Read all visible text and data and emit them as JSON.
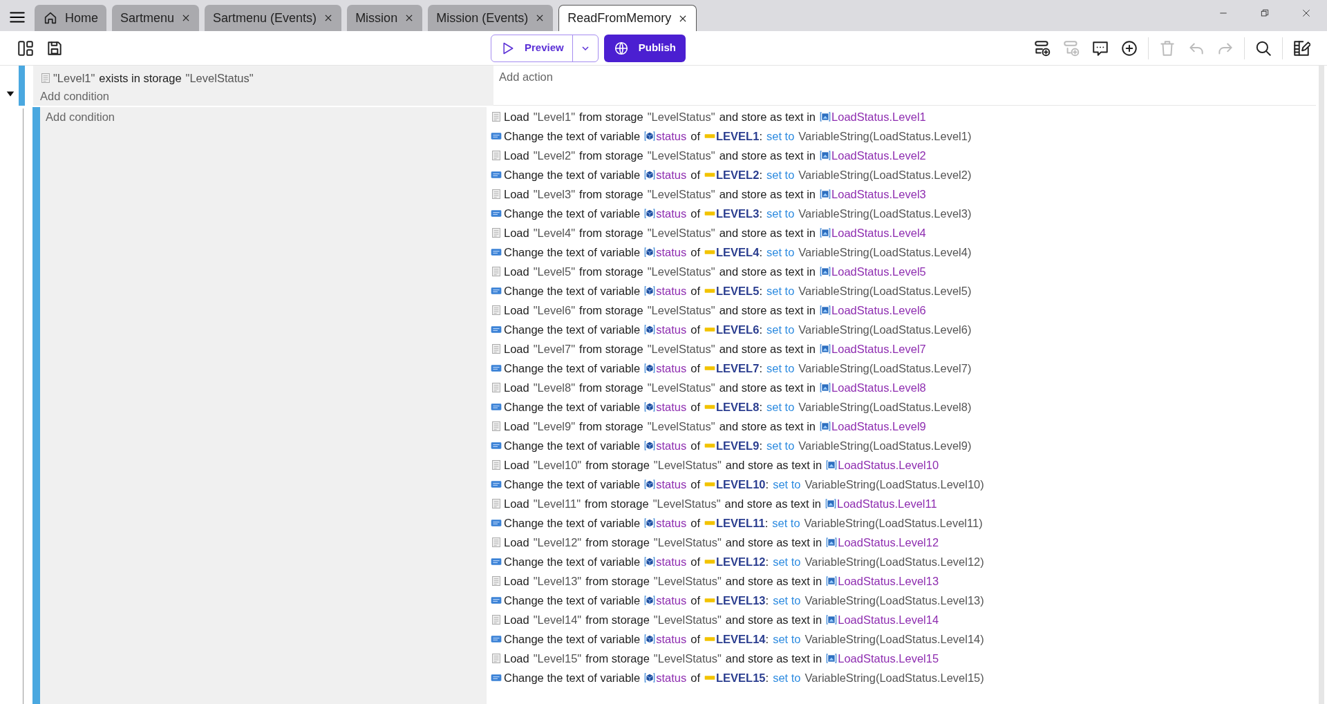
{
  "tabs": [
    {
      "label": "Home",
      "kind": "home",
      "selected": false
    },
    {
      "label": "Sartmenu",
      "kind": "doc",
      "selected": false
    },
    {
      "label": "Sartmenu (Events)",
      "kind": "doc",
      "selected": false
    },
    {
      "label": "Mission",
      "kind": "doc",
      "selected": false
    },
    {
      "label": "Mission (Events)",
      "kind": "doc",
      "selected": false
    },
    {
      "label": "ReadFromMemory",
      "kind": "doc",
      "selected": true
    }
  ],
  "toolbar": {
    "left": [
      {
        "kind": "layout",
        "disabled": false
      },
      {
        "kind": "save",
        "disabled": false
      }
    ],
    "preview": "Preview",
    "publish": "Publish",
    "right": [
      {
        "kind": "add-event",
        "disabled": false
      },
      {
        "kind": "add-subevent",
        "disabled": true
      },
      {
        "kind": "comment",
        "disabled": false
      },
      {
        "kind": "add",
        "disabled": false
      },
      {
        "kind": "sep"
      },
      {
        "kind": "delete",
        "disabled": true
      },
      {
        "kind": "undo",
        "disabled": true
      },
      {
        "kind": "redo",
        "disabled": true
      },
      {
        "kind": "sep"
      },
      {
        "kind": "search",
        "disabled": false
      },
      {
        "kind": "sep"
      },
      {
        "kind": "edit",
        "disabled": false
      }
    ]
  },
  "event": {
    "expanded": true,
    "conditions": [
      {
        "kind": "load",
        "parts": [
          {
            "kind": "lit",
            "text": "\"Level1\""
          },
          {
            "kind": "text",
            "text": "exists in storage"
          },
          {
            "kind": "lit",
            "text": "\"LevelStatus\""
          }
        ]
      }
    ],
    "add_condition": "Add condition",
    "add_action": "Add action",
    "sub_event": {
      "add_condition": "Add condition",
      "actions": [
        {
          "kind": "load",
          "parts": [
            {
              "kind": "text",
              "text": "Load"
            },
            {
              "kind": "lit",
              "text": "\"Level1\""
            },
            {
              "kind": "text",
              "text": "from storage"
            },
            {
              "kind": "lit",
              "text": "\"LevelStatus\""
            },
            {
              "kind": "text",
              "text": "and store as text in"
            },
            {
              "kind": "var",
              "text": "LoadStatus.Level1"
            }
          ]
        },
        {
          "kind": "setvar",
          "parts": [
            {
              "kind": "text",
              "text": "Change the text of variable"
            },
            {
              "kind": "objvar",
              "text": "status"
            },
            {
              "kind": "text",
              "text": "of"
            },
            {
              "kind": "object",
              "text": "LEVEL1"
            },
            {
              "kind": "punct",
              "text": ":"
            },
            {
              "kind": "op",
              "text": "set to"
            },
            {
              "kind": "lit",
              "text": "VariableString(LoadStatus.Level1)"
            }
          ]
        },
        {
          "kind": "load",
          "parts": [
            {
              "kind": "text",
              "text": "Load"
            },
            {
              "kind": "lit",
              "text": "\"Level2\""
            },
            {
              "kind": "text",
              "text": "from storage"
            },
            {
              "kind": "lit",
              "text": "\"LevelStatus\""
            },
            {
              "kind": "text",
              "text": "and store as text in"
            },
            {
              "kind": "var",
              "text": "LoadStatus.Level2"
            }
          ]
        },
        {
          "kind": "setvar",
          "parts": [
            {
              "kind": "text",
              "text": "Change the text of variable"
            },
            {
              "kind": "objvar",
              "text": "status"
            },
            {
              "kind": "text",
              "text": "of"
            },
            {
              "kind": "object",
              "text": "LEVEL2"
            },
            {
              "kind": "punct",
              "text": ":"
            },
            {
              "kind": "op",
              "text": "set to"
            },
            {
              "kind": "lit",
              "text": "VariableString(LoadStatus.Level2)"
            }
          ]
        },
        {
          "kind": "load",
          "parts": [
            {
              "kind": "text",
              "text": "Load"
            },
            {
              "kind": "lit",
              "text": "\"Level3\""
            },
            {
              "kind": "text",
              "text": "from storage"
            },
            {
              "kind": "lit",
              "text": "\"LevelStatus\""
            },
            {
              "kind": "text",
              "text": "and store as text in"
            },
            {
              "kind": "var",
              "text": "LoadStatus.Level3"
            }
          ]
        },
        {
          "kind": "setvar",
          "parts": [
            {
              "kind": "text",
              "text": "Change the text of variable"
            },
            {
              "kind": "objvar",
              "text": "status"
            },
            {
              "kind": "text",
              "text": "of"
            },
            {
              "kind": "object",
              "text": "LEVEL3"
            },
            {
              "kind": "punct",
              "text": ":"
            },
            {
              "kind": "op",
              "text": "set to"
            },
            {
              "kind": "lit",
              "text": "VariableString(LoadStatus.Level3)"
            }
          ]
        },
        {
          "kind": "load",
          "parts": [
            {
              "kind": "text",
              "text": "Load"
            },
            {
              "kind": "lit",
              "text": "\"Level4\""
            },
            {
              "kind": "text",
              "text": "from storage"
            },
            {
              "kind": "lit",
              "text": "\"LevelStatus\""
            },
            {
              "kind": "text",
              "text": "and store as text in"
            },
            {
              "kind": "var",
              "text": "LoadStatus.Level4"
            }
          ]
        },
        {
          "kind": "setvar",
          "parts": [
            {
              "kind": "text",
              "text": "Change the text of variable"
            },
            {
              "kind": "objvar",
              "text": "status"
            },
            {
              "kind": "text",
              "text": "of"
            },
            {
              "kind": "object",
              "text": "LEVEL4"
            },
            {
              "kind": "punct",
              "text": ":"
            },
            {
              "kind": "op",
              "text": "set to"
            },
            {
              "kind": "lit",
              "text": "VariableString(LoadStatus.Level4)"
            }
          ]
        },
        {
          "kind": "load",
          "parts": [
            {
              "kind": "text",
              "text": "Load"
            },
            {
              "kind": "lit",
              "text": "\"Level5\""
            },
            {
              "kind": "text",
              "text": "from storage"
            },
            {
              "kind": "lit",
              "text": "\"LevelStatus\""
            },
            {
              "kind": "text",
              "text": "and store as text in"
            },
            {
              "kind": "var",
              "text": "LoadStatus.Level5"
            }
          ]
        },
        {
          "kind": "setvar",
          "parts": [
            {
              "kind": "text",
              "text": "Change the text of variable"
            },
            {
              "kind": "objvar",
              "text": "status"
            },
            {
              "kind": "text",
              "text": "of"
            },
            {
              "kind": "object",
              "text": "LEVEL5"
            },
            {
              "kind": "punct",
              "text": ":"
            },
            {
              "kind": "op",
              "text": "set to"
            },
            {
              "kind": "lit",
              "text": "VariableString(LoadStatus.Level5)"
            }
          ]
        },
        {
          "kind": "load",
          "parts": [
            {
              "kind": "text",
              "text": "Load"
            },
            {
              "kind": "lit",
              "text": "\"Level6\""
            },
            {
              "kind": "text",
              "text": "from storage"
            },
            {
              "kind": "lit",
              "text": "\"LevelStatus\""
            },
            {
              "kind": "text",
              "text": "and store as text in"
            },
            {
              "kind": "var",
              "text": "LoadStatus.Level6"
            }
          ]
        },
        {
          "kind": "setvar",
          "parts": [
            {
              "kind": "text",
              "text": "Change the text of variable"
            },
            {
              "kind": "objvar",
              "text": "status"
            },
            {
              "kind": "text",
              "text": "of"
            },
            {
              "kind": "object",
              "text": "LEVEL6"
            },
            {
              "kind": "punct",
              "text": ":"
            },
            {
              "kind": "op",
              "text": "set to"
            },
            {
              "kind": "lit",
              "text": "VariableString(LoadStatus.Level6)"
            }
          ]
        },
        {
          "kind": "load",
          "parts": [
            {
              "kind": "text",
              "text": "Load"
            },
            {
              "kind": "lit",
              "text": "\"Level7\""
            },
            {
              "kind": "text",
              "text": "from storage"
            },
            {
              "kind": "lit",
              "text": "\"LevelStatus\""
            },
            {
              "kind": "text",
              "text": "and store as text in"
            },
            {
              "kind": "var",
              "text": "LoadStatus.Level7"
            }
          ]
        },
        {
          "kind": "setvar",
          "parts": [
            {
              "kind": "text",
              "text": "Change the text of variable"
            },
            {
              "kind": "objvar",
              "text": "status"
            },
            {
              "kind": "text",
              "text": "of"
            },
            {
              "kind": "object",
              "text": "LEVEL7"
            },
            {
              "kind": "punct",
              "text": ":"
            },
            {
              "kind": "op",
              "text": "set to"
            },
            {
              "kind": "lit",
              "text": "VariableString(LoadStatus.Level7)"
            }
          ]
        },
        {
          "kind": "load",
          "parts": [
            {
              "kind": "text",
              "text": "Load"
            },
            {
              "kind": "lit",
              "text": "\"Level8\""
            },
            {
              "kind": "text",
              "text": "from storage"
            },
            {
              "kind": "lit",
              "text": "\"LevelStatus\""
            },
            {
              "kind": "text",
              "text": "and store as text in"
            },
            {
              "kind": "var",
              "text": "LoadStatus.Level8"
            }
          ]
        },
        {
          "kind": "setvar",
          "parts": [
            {
              "kind": "text",
              "text": "Change the text of variable"
            },
            {
              "kind": "objvar",
              "text": "status"
            },
            {
              "kind": "text",
              "text": "of"
            },
            {
              "kind": "object",
              "text": "LEVEL8"
            },
            {
              "kind": "punct",
              "text": ":"
            },
            {
              "kind": "op",
              "text": "set to"
            },
            {
              "kind": "lit",
              "text": "VariableString(LoadStatus.Level8)"
            }
          ]
        },
        {
          "kind": "load",
          "parts": [
            {
              "kind": "text",
              "text": "Load"
            },
            {
              "kind": "lit",
              "text": "\"Level9\""
            },
            {
              "kind": "text",
              "text": "from storage"
            },
            {
              "kind": "lit",
              "text": "\"LevelStatus\""
            },
            {
              "kind": "text",
              "text": "and store as text in"
            },
            {
              "kind": "var",
              "text": "LoadStatus.Level9"
            }
          ]
        },
        {
          "kind": "setvar",
          "parts": [
            {
              "kind": "text",
              "text": "Change the text of variable"
            },
            {
              "kind": "objvar",
              "text": "status"
            },
            {
              "kind": "text",
              "text": "of"
            },
            {
              "kind": "object",
              "text": "LEVEL9"
            },
            {
              "kind": "punct",
              "text": ":"
            },
            {
              "kind": "op",
              "text": "set to"
            },
            {
              "kind": "lit",
              "text": "VariableString(LoadStatus.Level9)"
            }
          ]
        },
        {
          "kind": "load",
          "parts": [
            {
              "kind": "text",
              "text": "Load"
            },
            {
              "kind": "lit",
              "text": "\"Level10\""
            },
            {
              "kind": "text",
              "text": "from storage"
            },
            {
              "kind": "lit",
              "text": "\"LevelStatus\""
            },
            {
              "kind": "text",
              "text": "and store as text in"
            },
            {
              "kind": "var",
              "text": "LoadStatus.Level10"
            }
          ]
        },
        {
          "kind": "setvar",
          "parts": [
            {
              "kind": "text",
              "text": "Change the text of variable"
            },
            {
              "kind": "objvar",
              "text": "status"
            },
            {
              "kind": "text",
              "text": "of"
            },
            {
              "kind": "object",
              "text": "LEVEL10"
            },
            {
              "kind": "punct",
              "text": ":"
            },
            {
              "kind": "op",
              "text": "set to"
            },
            {
              "kind": "lit",
              "text": "VariableString(LoadStatus.Level10)"
            }
          ]
        },
        {
          "kind": "load",
          "parts": [
            {
              "kind": "text",
              "text": "Load"
            },
            {
              "kind": "lit",
              "text": "\"Level11\""
            },
            {
              "kind": "text",
              "text": "from storage"
            },
            {
              "kind": "lit",
              "text": "\"LevelStatus\""
            },
            {
              "kind": "text",
              "text": "and store as text in"
            },
            {
              "kind": "var",
              "text": "LoadStatus.Level11"
            }
          ]
        },
        {
          "kind": "setvar",
          "parts": [
            {
              "kind": "text",
              "text": "Change the text of variable"
            },
            {
              "kind": "objvar",
              "text": "status"
            },
            {
              "kind": "text",
              "text": "of"
            },
            {
              "kind": "object",
              "text": "LEVEL11"
            },
            {
              "kind": "punct",
              "text": ":"
            },
            {
              "kind": "op",
              "text": "set to"
            },
            {
              "kind": "lit",
              "text": "VariableString(LoadStatus.Level11)"
            }
          ]
        },
        {
          "kind": "load",
          "parts": [
            {
              "kind": "text",
              "text": "Load"
            },
            {
              "kind": "lit",
              "text": "\"Level12\""
            },
            {
              "kind": "text",
              "text": "from storage"
            },
            {
              "kind": "lit",
              "text": "\"LevelStatus\""
            },
            {
              "kind": "text",
              "text": "and store as text in"
            },
            {
              "kind": "var",
              "text": "LoadStatus.Level12"
            }
          ]
        },
        {
          "kind": "setvar",
          "parts": [
            {
              "kind": "text",
              "text": "Change the text of variable"
            },
            {
              "kind": "objvar",
              "text": "status"
            },
            {
              "kind": "text",
              "text": "of"
            },
            {
              "kind": "object",
              "text": "LEVEL12"
            },
            {
              "kind": "punct",
              "text": ":"
            },
            {
              "kind": "op",
              "text": "set to"
            },
            {
              "kind": "lit",
              "text": "VariableString(LoadStatus.Level12)"
            }
          ]
        },
        {
          "kind": "load",
          "parts": [
            {
              "kind": "text",
              "text": "Load"
            },
            {
              "kind": "lit",
              "text": "\"Level13\""
            },
            {
              "kind": "text",
              "text": "from storage"
            },
            {
              "kind": "lit",
              "text": "\"LevelStatus\""
            },
            {
              "kind": "text",
              "text": "and store as text in"
            },
            {
              "kind": "var",
              "text": "LoadStatus.Level13"
            }
          ]
        },
        {
          "kind": "setvar",
          "parts": [
            {
              "kind": "text",
              "text": "Change the text of variable"
            },
            {
              "kind": "objvar",
              "text": "status"
            },
            {
              "kind": "text",
              "text": "of"
            },
            {
              "kind": "object",
              "text": "LEVEL13"
            },
            {
              "kind": "punct",
              "text": ":"
            },
            {
              "kind": "op",
              "text": "set to"
            },
            {
              "kind": "lit",
              "text": "VariableString(LoadStatus.Level13)"
            }
          ]
        },
        {
          "kind": "load",
          "parts": [
            {
              "kind": "text",
              "text": "Load"
            },
            {
              "kind": "lit",
              "text": "\"Level14\""
            },
            {
              "kind": "text",
              "text": "from storage"
            },
            {
              "kind": "lit",
              "text": "\"LevelStatus\""
            },
            {
              "kind": "text",
              "text": "and store as text in"
            },
            {
              "kind": "var",
              "text": "LoadStatus.Level14"
            }
          ]
        },
        {
          "kind": "setvar",
          "parts": [
            {
              "kind": "text",
              "text": "Change the text of variable"
            },
            {
              "kind": "objvar",
              "text": "status"
            },
            {
              "kind": "text",
              "text": "of"
            },
            {
              "kind": "object",
              "text": "LEVEL14"
            },
            {
              "kind": "punct",
              "text": ":"
            },
            {
              "kind": "op",
              "text": "set to"
            },
            {
              "kind": "lit",
              "text": "VariableString(LoadStatus.Level14)"
            }
          ]
        },
        {
          "kind": "load",
          "parts": [
            {
              "kind": "text",
              "text": "Load"
            },
            {
              "kind": "lit",
              "text": "\"Level15\""
            },
            {
              "kind": "text",
              "text": "from storage"
            },
            {
              "kind": "lit",
              "text": "\"LevelStatus\""
            },
            {
              "kind": "text",
              "text": "and store as text in"
            },
            {
              "kind": "var",
              "text": "LoadStatus.Level15"
            }
          ]
        },
        {
          "kind": "setvar",
          "parts": [
            {
              "kind": "text",
              "text": "Change the text of variable"
            },
            {
              "kind": "objvar",
              "text": "status"
            },
            {
              "kind": "text",
              "text": "of"
            },
            {
              "kind": "object",
              "text": "LEVEL15"
            },
            {
              "kind": "punct",
              "text": ":"
            },
            {
              "kind": "op",
              "text": "set to"
            },
            {
              "kind": "lit",
              "text": "VariableString(LoadStatus.Level15)"
            }
          ]
        }
      ]
    }
  }
}
